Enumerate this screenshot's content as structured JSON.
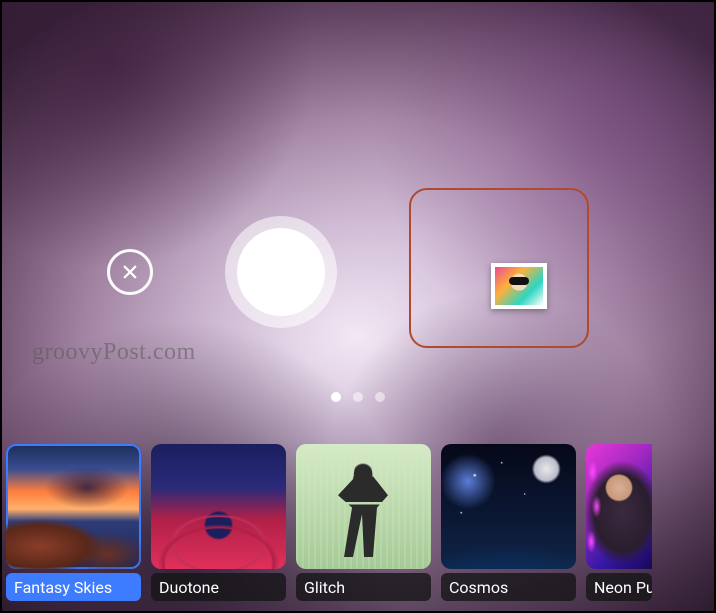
{
  "watermark": "groovyPost.com",
  "pager": {
    "count": 3,
    "active_index": 0
  },
  "controls": {
    "close_icon": "close-icon",
    "shutter_icon": "shutter-icon",
    "gallery_icon": "gallery-icon"
  },
  "filters": {
    "selected_index": 0,
    "items": [
      {
        "label": "Fantasy Skies",
        "thumb_class": "thumb-fantasy"
      },
      {
        "label": "Duotone",
        "thumb_class": "thumb-duotone"
      },
      {
        "label": "Glitch",
        "thumb_class": "thumb-glitch"
      },
      {
        "label": "Cosmos",
        "thumb_class": "thumb-cosmos"
      },
      {
        "label": "Neon Puls",
        "thumb_class": "thumb-neon"
      }
    ]
  },
  "colors": {
    "accent": "#3d7bff",
    "highlight_border": "#b04a2e"
  }
}
